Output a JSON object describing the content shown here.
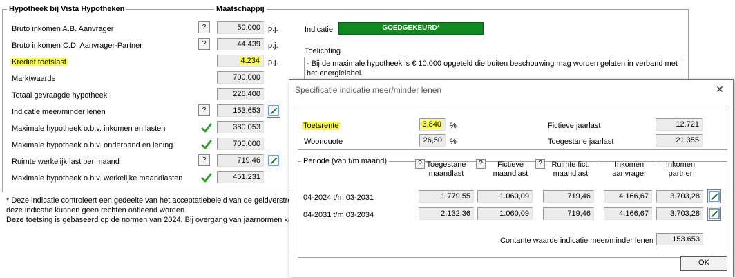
{
  "main": {
    "group_title": "Hypotheek bij Vista Hypotheken",
    "column_header": "Maatschappij",
    "rows": [
      {
        "label": "Bruto inkomen A.B. Aanvrager",
        "value": "50.000",
        "unit": "p.j.",
        "control": "help"
      },
      {
        "label": "Bruto inkomen C.D. Aanvrager-Partner",
        "value": "44.439",
        "unit": "p.j.",
        "control": "help"
      },
      {
        "label": "Krediet toetslast",
        "value": "4.234",
        "unit": "p.j.",
        "control": "none"
      },
      {
        "label": "Marktwaarde",
        "value": "700.000",
        "unit": "",
        "control": "none"
      },
      {
        "label": "Totaal gevraagde hypotheek",
        "value": "226.400",
        "unit": "",
        "control": "none"
      },
      {
        "label": "Indicatie meer/minder lenen",
        "value": "153.653",
        "unit": "",
        "control": "help"
      },
      {
        "label": "Maximale hypotheek o.b.v. inkomen en lasten",
        "value": "380.053",
        "unit": "",
        "control": "check"
      },
      {
        "label": "Maximale hypotheek o.b.v. onderpand en lening",
        "value": "700.000",
        "unit": "",
        "control": "check"
      },
      {
        "label": "Ruimte werkelijk last per maand",
        "value": "719,46",
        "unit": "",
        "control": "help"
      },
      {
        "label": "Maximale hypotheek o.b.v. werkelijke maandlasten",
        "value": "451.231",
        "unit": "",
        "control": "check"
      }
    ],
    "help_label": "?",
    "indicatie_label": "Indicatie",
    "indicatie_status": "GOEDGEKEURD*",
    "toelichting_label": "Toelichting",
    "toelichting_text": "- Bij de maximale hypotheek is € 10.000 opgeteld die buiten beschouwing mag worden gelaten in verband met het energielabel.",
    "footnote_lines": [
      "* Deze indicatie controleert een gedeelte van het acceptatiebeleid van de geldverstrek",
      "deze indicatie kunnen geen rechten ontleend worden.",
      "Deze toetsing is gebaseerd op de normen van 2024. Bij overgang van jaarnormen kan"
    ]
  },
  "dialog": {
    "title": "Specificatie indicatie meer/minder lenen",
    "close_symbol": "✕",
    "toetsrente_label": "Toetsrente",
    "toetsrente_value": "3,840",
    "woonquote_label": "Woonquote",
    "woonquote_value": "26,50",
    "percent": "%",
    "fictieve_jaarlast_label": "Fictieve jaarlast",
    "fictieve_jaarlast_value": "12.721",
    "toegestane_jaarlast_label": "Toegestane jaarlast",
    "toegestane_jaarlast_value": "21.355",
    "periode_label": "Periode (van t/m maand)",
    "columns": [
      {
        "line1": "Toegestane",
        "line2": "maandlast"
      },
      {
        "line1": "Fictieve",
        "line2": "maandlast"
      },
      {
        "line1": "Ruimte fict.",
        "line2": "maandlast"
      },
      {
        "line1": "Inkomen",
        "line2": "aanvrager"
      },
      {
        "line1": "Inkomen",
        "line2": "partner"
      }
    ],
    "rows": [
      {
        "periode": "04-2024 t/m 03-2031",
        "values": [
          "1.779,55",
          "1.060,09",
          "719,46",
          "4.166,67",
          "3.703,28"
        ]
      },
      {
        "periode": "04-2031 t/m 03-2034",
        "values": [
          "2.132,36",
          "1.060,09",
          "719,46",
          "4.166,67",
          "3.703,28"
        ]
      }
    ],
    "contante_label": "Contante waarde indicatie meer/minder lenen",
    "contante_value": "153.653",
    "ok_label": "OK"
  }
}
